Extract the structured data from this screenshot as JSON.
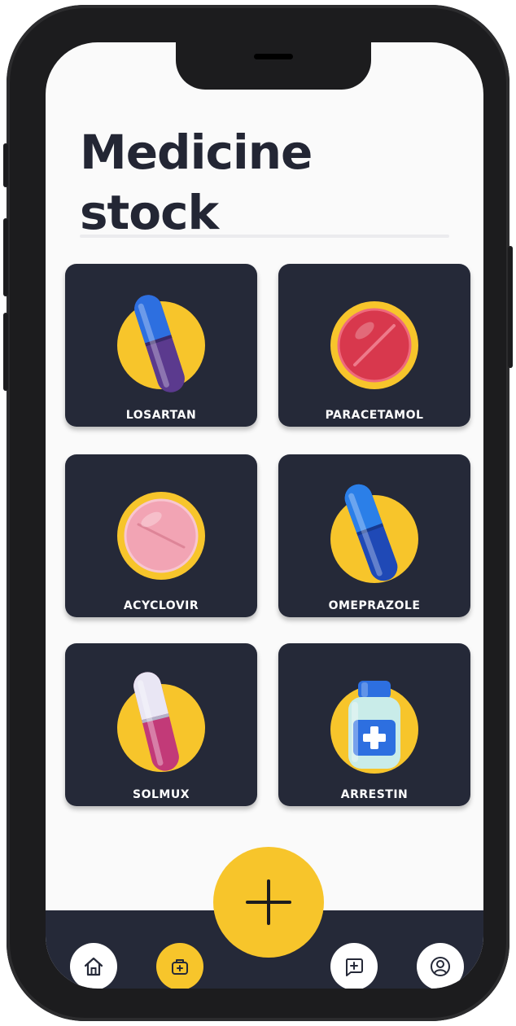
{
  "page": {
    "title_line1": "Medicine",
    "title_line2": "stock"
  },
  "medicines": [
    {
      "name": "LOSARTAN",
      "icon": "capsule-blue-purple-icon"
    },
    {
      "name": "PARACETAMOL",
      "icon": "red-tablet-icon"
    },
    {
      "name": "ACYCLOVIR",
      "icon": "pink-tablet-icon"
    },
    {
      "name": "OMEPRAZOLE",
      "icon": "capsule-blue-icon"
    },
    {
      "name": "SOLMUX",
      "icon": "capsule-pink-white-icon"
    },
    {
      "name": "ARRESTIN",
      "icon": "medicine-bottle-icon"
    }
  ],
  "navbar": {
    "items": [
      {
        "name": "home",
        "icon": "home-icon",
        "active": false
      },
      {
        "name": "stock",
        "icon": "medicine-box-icon",
        "active": true
      },
      {
        "name": "add-prescription",
        "icon": "add-bubble-icon",
        "active": false
      },
      {
        "name": "profile",
        "icon": "user-icon",
        "active": false
      }
    ],
    "fab_icon": "plus-icon"
  },
  "colors": {
    "accent": "#f7c52b",
    "card": "#252938",
    "title": "#232634",
    "background": "#fafafa"
  }
}
